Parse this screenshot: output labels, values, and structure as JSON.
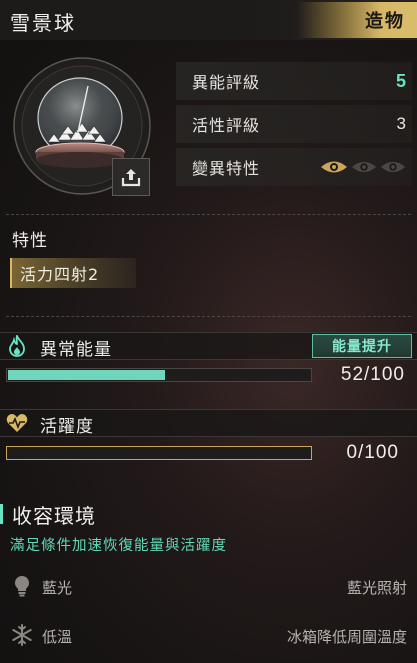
{
  "header": {
    "title": "雪景球",
    "tag": "造物"
  },
  "stats": [
    {
      "label": "異能評級",
      "value": "5",
      "highlight": true
    },
    {
      "label": "活性評級",
      "value": "3",
      "highlight": false
    },
    {
      "label": "變異特性",
      "value": "",
      "eyes_active": 1,
      "eyes_total": 3
    }
  ],
  "traits": {
    "heading": "特性",
    "items": [
      "活力四射2"
    ]
  },
  "energy": {
    "label": "異常能量",
    "boost_label": "能量提升",
    "current": 52,
    "max": 100,
    "display": "52/100",
    "fill_fraction": 0.52,
    "color": "#6fd6bd"
  },
  "vitality": {
    "label": "活躍度",
    "current": 0,
    "max": 100,
    "display": "0/100",
    "fill_fraction": 0.0,
    "color": "#c9a65a"
  },
  "environment": {
    "title": "收容環境",
    "subtitle": "滿足條件加速恢復能量與活躍度",
    "rows": [
      {
        "icon": "lightbulb-icon",
        "name": "藍光",
        "desc": "藍光照射"
      },
      {
        "icon": "snowflake-icon",
        "name": "低溫",
        "desc": "冰箱降低周圍溫度"
      }
    ]
  },
  "colors": {
    "accent": "#6be3c3",
    "gold": "#d9b866"
  }
}
